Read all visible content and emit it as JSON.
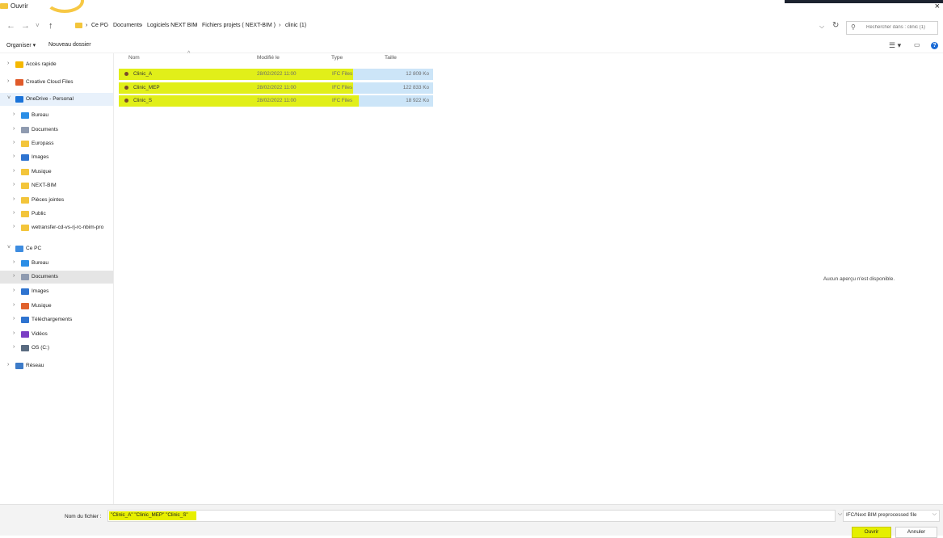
{
  "window": {
    "title": "Ouvrir",
    "close": "×"
  },
  "nav": {
    "back": "←",
    "forward": "→",
    "recent": "˅",
    "up": "↑",
    "breadcrumb": [
      "›",
      "Ce PC",
      "›",
      "Documents",
      "›",
      "Logiciels NEXT BIM",
      "›",
      "Fichiers projets ( NEXT-BIM )",
      "›",
      "clinic (1)"
    ],
    "refresh": "↻",
    "search_placeholder": "Rechercher dans : clinic (1)"
  },
  "toolbar": {
    "organize": "Organiser ▾",
    "new_folder": "Nouveau dossier",
    "view": "☰ ▾"
  },
  "sidebar": [
    {
      "label": "Accès rapide",
      "indent": 0,
      "color": "#f5b800",
      "chev": "›"
    },
    {
      "label": "Creative Cloud Files",
      "indent": 0,
      "color": "#e05a2a",
      "chev": "›"
    },
    {
      "label": "OneDrive - Personal",
      "indent": 0,
      "color": "#1a73d9",
      "chev": "˅",
      "selected": true
    },
    {
      "label": "Bureau",
      "indent": 1,
      "color": "#2b8ee6",
      "chev": "›"
    },
    {
      "label": "Documents",
      "indent": 1,
      "color": "#8f9bb0",
      "chev": "›"
    },
    {
      "label": "Europass",
      "indent": 1,
      "color": "#f3c53b",
      "chev": "›"
    },
    {
      "label": "Images",
      "indent": 1,
      "color": "#2f74d0",
      "chev": "›"
    },
    {
      "label": "Musique",
      "indent": 1,
      "color": "#f3c53b",
      "chev": "›"
    },
    {
      "label": "NEXT-BIM",
      "indent": 1,
      "color": "#f3c53b",
      "chev": "›"
    },
    {
      "label": "Pièces jointes",
      "indent": 1,
      "color": "#f3c53b",
      "chev": "›"
    },
    {
      "label": "Public",
      "indent": 1,
      "color": "#f3c53b",
      "chev": "›"
    },
    {
      "label": "wetransfer-cd-vs-rj-rc-nbim-pro",
      "indent": 1,
      "color": "#f3c53b",
      "chev": "›"
    },
    {
      "label": "Ce PC",
      "indent": 0,
      "color": "#3d8ce0",
      "chev": "˅"
    },
    {
      "label": "Bureau",
      "indent": 1,
      "color": "#2b8ee6",
      "chev": "›"
    },
    {
      "label": "Documents",
      "indent": 1,
      "color": "#8f9bb0",
      "chev": "›",
      "selected": true
    },
    {
      "label": "Images",
      "indent": 1,
      "color": "#2f74d0",
      "chev": "›"
    },
    {
      "label": "Musique",
      "indent": 1,
      "color": "#e0622d",
      "chev": "›"
    },
    {
      "label": "Téléchargements",
      "indent": 1,
      "color": "#2f74d0",
      "chev": "›"
    },
    {
      "label": "Vidéos",
      "indent": 1,
      "color": "#7b3fc4",
      "chev": "›"
    },
    {
      "label": "OS (C:)",
      "indent": 1,
      "color": "#5a6b80",
      "chev": "›"
    },
    {
      "label": "Réseau",
      "indent": 0,
      "color": "#3d7bc8",
      "chev": "›"
    }
  ],
  "columns": {
    "name": "Nom",
    "modified": "Modifié le",
    "type": "Type",
    "size": "Taille"
  },
  "files": [
    {
      "name": "Clinic_A",
      "modified": "28/02/2022 11:00",
      "type": "IFC Files",
      "size": "12 809 Ko"
    },
    {
      "name": "Clinic_MEP",
      "modified": "28/02/2022 11:00",
      "type": "IFC Files",
      "size": "122 833 Ko"
    },
    {
      "name": "Clinic_S",
      "modified": "28/02/2022 11:00",
      "type": "IFC Files",
      "size": "18 922 Ko"
    }
  ],
  "preview": {
    "message": "Aucun aperçu n'est disponible."
  },
  "footer": {
    "filename_label": "Nom du fichier :",
    "filename_value": "\"Clinic_A\" \"Clinic_MEP\" \"Clinic_S\"",
    "filetype": "IFC/Next BIM preprocessed file",
    "open": "Ouvrir",
    "cancel": "Annuler"
  },
  "colors": {
    "highlight": "#e3ef00",
    "selection": "#cce5f8",
    "folder": "#f3c53b"
  }
}
